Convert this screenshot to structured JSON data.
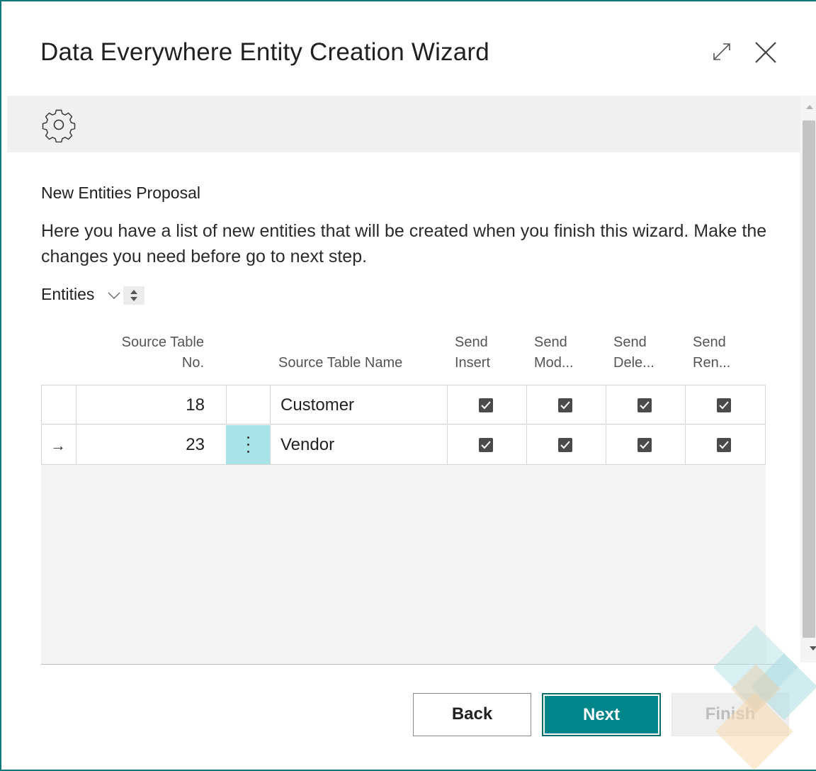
{
  "dialog": {
    "title": "Data Everywhere Entity Creation Wizard",
    "expand_icon": "expand-icon",
    "close_icon": "close-icon"
  },
  "toolbar": {
    "icon": "gear-icon"
  },
  "section": {
    "heading": "New Entities Proposal",
    "instructions": "Here you have a list of new entities that will be created when you finish this wizard. Make the changes you need before go to next step."
  },
  "entities": {
    "label": "Entities",
    "columns": {
      "source_table_no_1": "Source Table",
      "source_table_no_2": "No.",
      "source_table_name": "Source Table Name",
      "send_insert_1": "Send",
      "send_insert_2": "Insert",
      "send_modify_1": "Send",
      "send_modify_2": "Mod...",
      "send_delete_1": "Send",
      "send_delete_2": "Dele...",
      "send_rename_1": "Send",
      "send_rename_2": "Ren..."
    },
    "rows": [
      {
        "no": "18",
        "name": "Customer",
        "send_insert": true,
        "send_modify": true,
        "send_delete": true,
        "send_rename": true,
        "selected": false
      },
      {
        "no": "23",
        "name": "Vendor",
        "send_insert": true,
        "send_modify": true,
        "send_delete": true,
        "send_rename": true,
        "selected": true,
        "row_marker": "→"
      }
    ]
  },
  "buttons": {
    "back": "Back",
    "next": "Next",
    "finish": "Finish"
  },
  "colors": {
    "accent": "#00858a",
    "border": "#0e7a7a",
    "selected_cell": "#a8e3e8"
  }
}
